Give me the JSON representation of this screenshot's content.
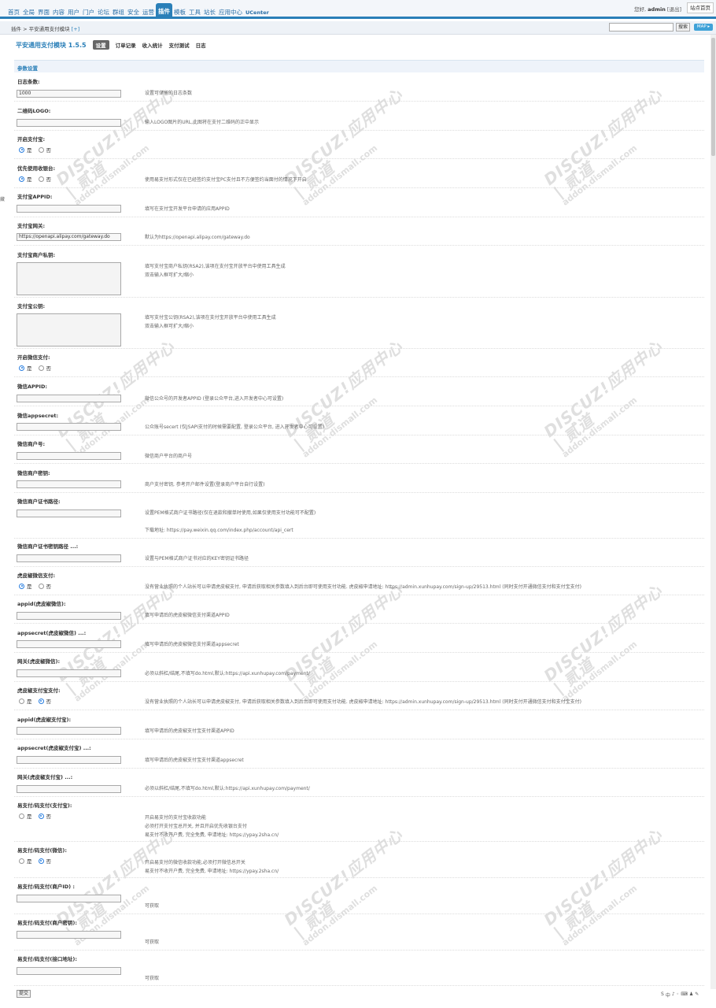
{
  "nav": {
    "items": [
      "首页",
      "全局",
      "界面",
      "内容",
      "用户",
      "门户",
      "论坛",
      "群组",
      "安全",
      "运营",
      "插件",
      "模板",
      "工具",
      "站长",
      "应用中心",
      "UCenter"
    ],
    "active_index": 10,
    "greeting": "您好,",
    "username": "admin",
    "logout": "[退出]",
    "home_button": "站点首页"
  },
  "subbar": {
    "crumb_prefix": "插件 > 平安通用支付模块",
    "crumb_add": "[+]",
    "search_button": "搜索",
    "map_button": "MAP ▸"
  },
  "left_edge_text": "藏",
  "page": {
    "title": "平安通用支付模块 1.5.5",
    "tabs": [
      "设置",
      "订单记录",
      "收入统计",
      "支付测试",
      "日志"
    ],
    "active_tab": 0,
    "section": "参数设置"
  },
  "fields": {
    "f1": {
      "label": "日志条数:",
      "value": "1000",
      "comment": "设置可储留的日志条数"
    },
    "f2": {
      "label": "二维码LOGO:",
      "value": "",
      "comment": "输入LOGO图片的URL,此图将在支付二维码的正中显示"
    },
    "f3": {
      "label": "开启支付宝:",
      "options": [
        "是",
        "否"
      ],
      "selected": 0
    },
    "f4": {
      "label": "优先使用收银台:",
      "options": [
        "是",
        "否"
      ],
      "selected": 0,
      "comment": "使用易支付形式仅在已经签约支付宝PC支付且不方便签约当面付的情况下开启"
    },
    "f5": {
      "label": "支付宝APPID:",
      "value": "",
      "comment": "填写在支付宝开发平台申请的应用APPID"
    },
    "f6": {
      "label": "支付宝网关:",
      "value": "https://openapi.alipay.com/gateway.do",
      "comment": "默认为https://openapi.alipay.com/gateway.do"
    },
    "f7": {
      "label": "支付宝商户私钥:",
      "comment1": "填写支付宝商户私钥(RSA2),该项在支付宝开放平台中使用工具生成",
      "comment2": "双击输入框可扩大/缩小"
    },
    "f8": {
      "label": "支付宝公钥:",
      "comment1": "填写支付宝公钥(RSA2),该项在支付宝开放平台中使用工具生成",
      "comment2": "双击输入框可扩大/缩小"
    },
    "f9": {
      "label": "开启微信支付:",
      "options": [
        "是",
        "否"
      ],
      "selected": 0
    },
    "f10": {
      "label": "微信APPID:",
      "value": "",
      "comment": "微信公众号的开发者APPID (登录公众平台,进入开发者中心可设置)"
    },
    "f11": {
      "label": "微信appsecret:",
      "value": "",
      "comment": "公众账号secert (仅JSAPI支付的时候需要配置, 登录公众平台, 进入开发者中心可设置)"
    },
    "f12": {
      "label": "微信商户号:",
      "value": "",
      "comment": "微信商户平台的商户号"
    },
    "f13": {
      "label": "微信商户密钥:",
      "value": "",
      "comment": "商户支付密钥, 参考开户邮件设置(登录商户平台自行设置)"
    },
    "f14": {
      "label": "微信商户证书路径:",
      "value": "",
      "comment1": "设置PEM格式商户证书路径(仅在退款和撤单时使用,如果仅使用支付功能可不配置)",
      "comment2": "下载地址: https://pay.weixin.qq.com/index.php/account/api_cert"
    },
    "f15": {
      "label": "微信商户证书密钥路径 ...:",
      "value": "",
      "comment": "设置与PEM格式商户证书对应的KEY密钥证书路径"
    },
    "f16": {
      "label": "虎皮椒微信支付:",
      "options": [
        "是",
        "否"
      ],
      "selected": 0,
      "comment": "没有营业执照的个人站长可以申请虎皮椒支付, 申请后获取相关参数填入到后台即可使用支付功能. 虎皮椒申请地址: https://admin.xunhupay.com/sign-up/29513.html (同时支付开通微信支付和支付宝支付)"
    },
    "f17": {
      "label": "appid(虎皮椒微信):",
      "value": "",
      "comment": "填写申请后的虎皮椒微信支付渠道APPID"
    },
    "f18": {
      "label": "appsecret(虎皮椒微信) ...:",
      "value": "",
      "comment": "填写申请后的虎皮椒微信支付渠道appsecret"
    },
    "f19": {
      "label": "网关(虎皮椒微信):",
      "value": "",
      "comment": "必须以斜杠/结尾,不填写do.html,默认:https://api.xunhupay.com/payment/"
    },
    "f20": {
      "label": "虎皮椒支付宝支付:",
      "options": [
        "是",
        "否"
      ],
      "selected": 1,
      "comment": "没有营业执照的个人站长可以申请虎皮椒支付, 申请后获取相关参数填入到后台即可使用支付功能. 虎皮椒申请地址: https://admin.xunhupay.com/sign-up/29513.html (同时支付开通微信支付和支付宝支付)"
    },
    "f21": {
      "label": "appid(虎皮椒支付宝):",
      "value": "",
      "comment": "填写申请后的虎皮椒支付宝支付渠道APPID"
    },
    "f22": {
      "label": "appsecret(虎皮椒支付宝) ...:",
      "value": "",
      "comment": "填写申请后的虎皮椒支付宝支付渠道appsecret"
    },
    "f23": {
      "label": "网关(虎皮椒支付宝) ...:",
      "value": "",
      "comment": "必须以斜杠/结尾,不填写do.html,默认:https://api.xunhupay.com/payment/"
    },
    "f24": {
      "label": "易支付/码支付(支付宝):",
      "options": [
        "是",
        "否"
      ],
      "selected": 1,
      "comment1": "开启易支付的支付宝收款功能",
      "comment2": "必须打开支付宝总开关, 并且开启优先收银台支付",
      "comment3": "易支付不收开户费, 完全免费, 申请地址: https://ypay.2sha.cn/"
    },
    "f25": {
      "label": "易支付/码支付(微信):",
      "options": [
        "是",
        "否"
      ],
      "selected": 1,
      "comment1": "开启易支付的微信收款功能,必须打开微信总开关",
      "comment2": "易支付不收开户费, 完全免费, 申请地址: https://ypay.2sha.cn/"
    },
    "f26": {
      "label": "易支付/码支付(商户ID) :",
      "value": "",
      "comment": "可获取"
    },
    "f27": {
      "label": "易支付/码支付(商户密钥):",
      "value": "",
      "comment": "可获取"
    },
    "f28": {
      "label": "易支付/码支付(接口地址):",
      "value": "",
      "comment": "可获取"
    }
  },
  "submit_label": "提交",
  "ime_toolbar": [
    "S",
    "中",
    "♪",
    "◦",
    "⌨",
    "♟",
    "✎"
  ],
  "watermark": {
    "line1": "DISCUZ!应用中心 | 贰道",
    "line2": "addon.dismall.com"
  }
}
